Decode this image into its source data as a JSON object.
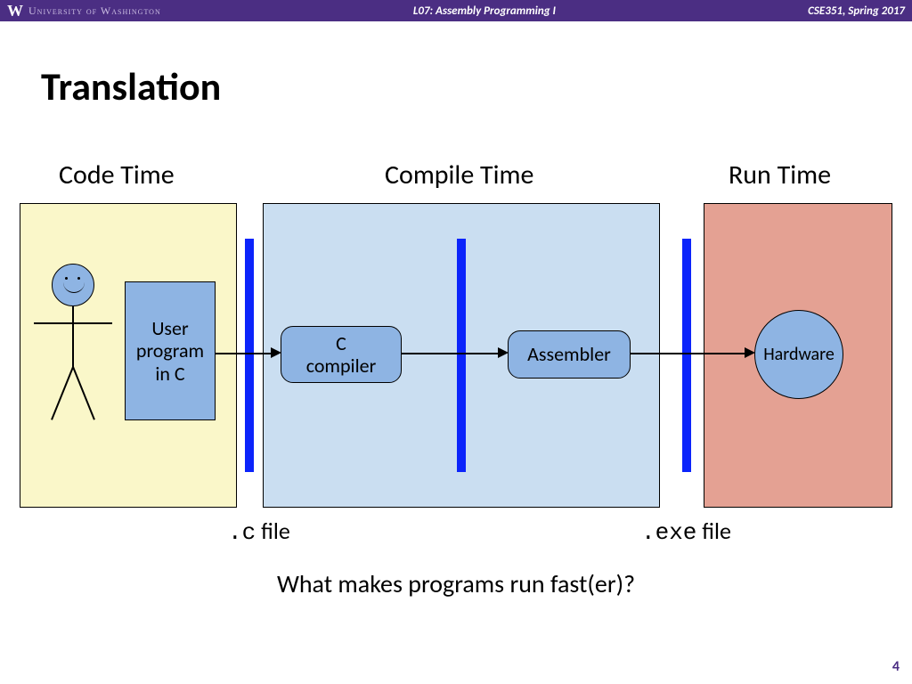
{
  "header": {
    "university_word": "W",
    "university_text": "University of Washington",
    "lecture": "L07: Assembly Programming I",
    "course": "CSE351, Spring 2017"
  },
  "title": "Translation",
  "phases": {
    "code": "Code Time",
    "compile": "Compile Time",
    "run": "Run Time"
  },
  "nodes": {
    "user_program": "User\nprogram\nin C",
    "compiler": "C\ncompiler",
    "assembler": "Assembler",
    "hardware": "Hardware"
  },
  "files": {
    "c_ext": ".c",
    "c_word": " file",
    "exe_ext": ".exe",
    "exe_word": " file"
  },
  "question": "What makes programs run fast(er)?",
  "pagenum": "4"
}
